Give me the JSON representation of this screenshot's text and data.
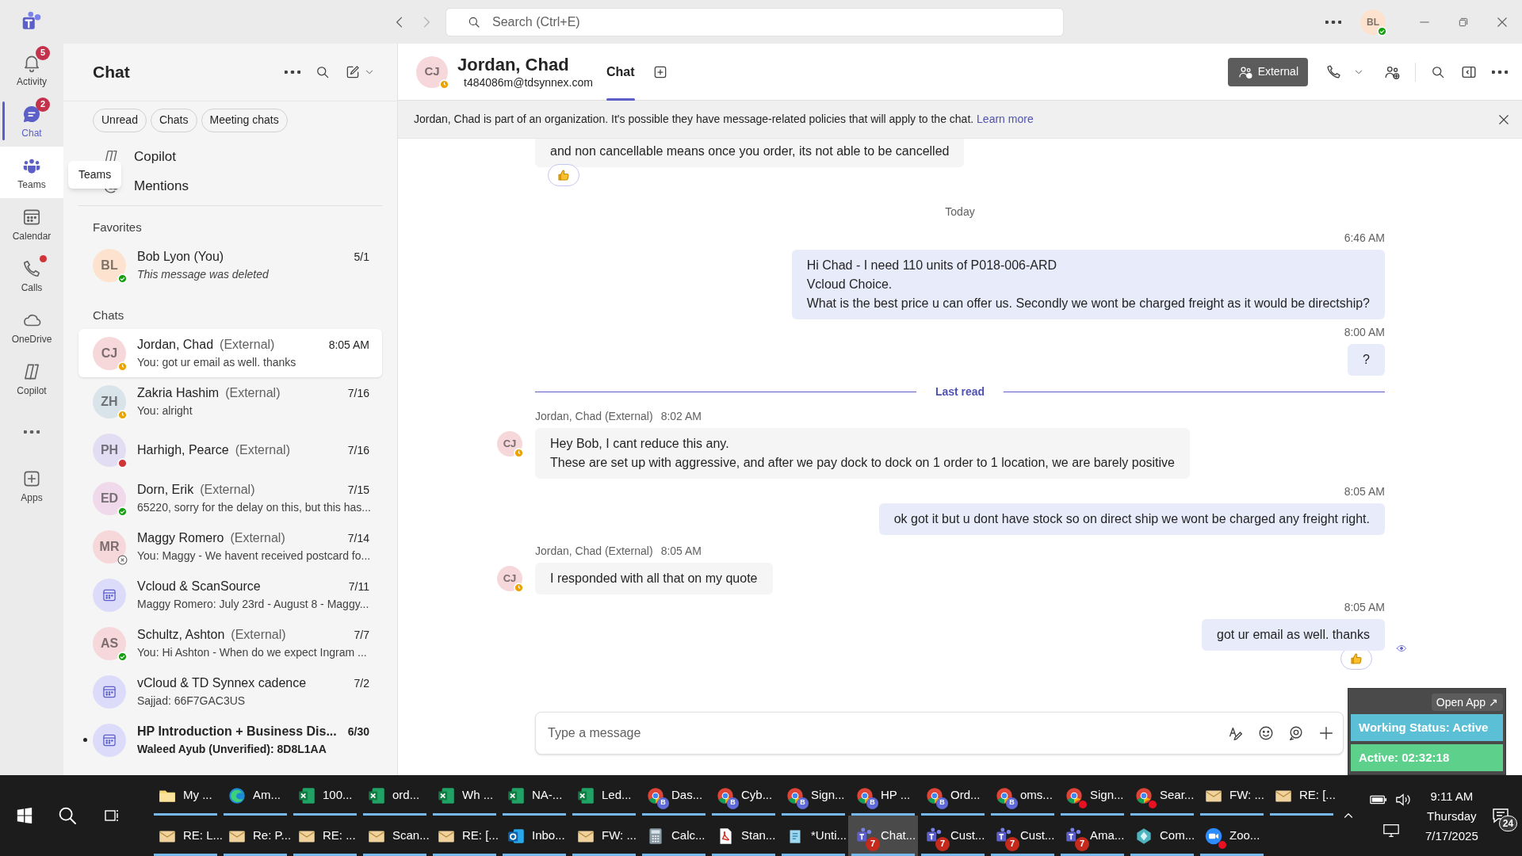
{
  "title_bar": {
    "search": {
      "placeholder": "Search (Ctrl+E)"
    },
    "avatar": {
      "initials": "BL",
      "color": "#fde3cf",
      "status": {
        "kind": "available"
      }
    }
  },
  "rail": [
    {
      "kind": "activity",
      "label": "Activity",
      "badge": "5",
      "selected": false,
      "dot": false
    },
    {
      "kind": "chat",
      "label": "Chat",
      "badge": "2",
      "selected": true,
      "dot": false
    },
    {
      "kind": "teams",
      "label": "Teams",
      "tooltip": "Teams",
      "selected": false,
      "dot": false
    },
    {
      "kind": "calendar",
      "label": "Calendar",
      "selected": false,
      "dot": false
    },
    {
      "kind": "calls",
      "label": "Calls",
      "selected": false,
      "dot": true
    },
    {
      "kind": "onedrive",
      "label": "OneDrive",
      "selected": false,
      "dot": false
    },
    {
      "kind": "copilot",
      "label": "Copilot",
      "selected": false,
      "dot": false
    },
    {
      "kind": "more",
      "selected": false,
      "dot": false
    },
    {
      "kind": "apps",
      "label": "Apps",
      "selected": false,
      "dot": false
    }
  ],
  "chat_list": {
    "title": "Chat",
    "filters": [
      "Unread",
      "Chats",
      "Meeting chats"
    ],
    "shortcuts": [
      {
        "kind": "copilot",
        "label": "Copilot"
      },
      {
        "kind": "mention",
        "label": "Mentions"
      }
    ],
    "favorites": {
      "heading": "Favorites",
      "items": [
        {
          "kind": "person",
          "initials": "BL",
          "color": "#fde3cf",
          "status": {
            "kind": "available"
          },
          "name": "Bob Lyon (You)",
          "time": "5/1",
          "preview": "This message was deleted",
          "deleted": true,
          "selected": false,
          "unread": false
        }
      ]
    },
    "chats": {
      "heading": "Chats",
      "items": [
        {
          "kind": "person",
          "initials": "CJ",
          "color": "#f6d8db",
          "status": {
            "kind": "away"
          },
          "name": "Jordan, Chad",
          "tag": "(External)",
          "time": "8:05 AM",
          "preview": "You: got ur email as well. thanks",
          "selected": true,
          "unread": false
        },
        {
          "kind": "person",
          "initials": "ZH",
          "color": "#d8e4ea",
          "status": {
            "kind": "away"
          },
          "name": "Zakria Hashim",
          "tag": "(External)",
          "time": "7/16",
          "preview": "You: alright",
          "selected": false,
          "unread": false
        },
        {
          "kind": "person",
          "initials": "PH",
          "color": "#e2ddf2",
          "status": {
            "kind": "busy"
          },
          "name": "Harhigh, Pearce",
          "tag": "(External)",
          "time": "7/16",
          "selected": false,
          "unread": false
        },
        {
          "kind": "person",
          "initials": "ED",
          "color": "#efd9ea",
          "status": {
            "kind": "available"
          },
          "name": "Dorn, Erik",
          "tag": "(External)",
          "time": "7/15",
          "preview": "65220, sorry for the delay on this, but this has...",
          "selected": false,
          "unread": false
        },
        {
          "kind": "person",
          "initials": "MR",
          "color": "#f6d8db",
          "status": {
            "kind": "offline"
          },
          "name": "Maggy Romero",
          "tag": "(External)",
          "time": "7/14",
          "preview": "You: Maggy - We havent received postcard fo...",
          "selected": false,
          "unread": false
        },
        {
          "kind": "meeting",
          "name": "Vcloud & ScanSource",
          "time": "7/11",
          "preview": "Maggy Romero: July 23rd - August 8 - Maggy...",
          "selected": false,
          "unread": false
        },
        {
          "kind": "person",
          "initials": "AS",
          "color": "#f6d8db",
          "status": {
            "kind": "available"
          },
          "name": "Schultz, Ashton",
          "tag": "(External)",
          "time": "7/7",
          "preview": "You: Hi Ashton -  When do we expect Ingram ...",
          "selected": false,
          "unread": false
        },
        {
          "kind": "meeting",
          "name": "vCloud & TD Synnex cadence",
          "time": "7/2",
          "preview": "Sajjad: 66F7GAC3US",
          "selected": false,
          "unread": false
        },
        {
          "kind": "meeting",
          "name": "HP Introduction + Business Dis...",
          "time": "6/30",
          "preview": "Waleed Ayub (Unverified): 8D8L1AA",
          "selected": false,
          "unread": true
        }
      ]
    }
  },
  "conversation": {
    "avatar": {
      "initials": "CJ",
      "color": "#f6d8db",
      "status": {
        "kind": "away"
      }
    },
    "name": "Jordan, Chad",
    "email": "t484086m@tdsynnex.com",
    "tabs": [
      {
        "label": "Chat",
        "selected": true
      }
    ],
    "external_button": "External",
    "banner": {
      "text": "Jordan, Chad is part of an organization. It's possible they have message-related policies that will apply to the chat.",
      "link": "Learn more"
    },
    "messages": [
      {
        "kind": "incoming",
        "lines": [
          "and non cancellable means once you order, its not able to be cancelled"
        ],
        "reaction": {
          "kind": "like"
        }
      },
      {
        "kind": "day",
        "text": "Today"
      },
      {
        "kind": "outgoing",
        "time": "6:46 AM",
        "lines": [
          "Hi Chad -  I need 110 units of P018-006-ARD",
          "Vcloud Choice.",
          "What is the best price u can offer us. Secondly we wont be charged freight as it would be directship?"
        ]
      },
      {
        "kind": "outgoing",
        "time": "8:00 AM",
        "lines": [
          "?"
        ]
      },
      {
        "kind": "last_read",
        "text": "Last read"
      },
      {
        "kind": "incoming",
        "sender": "Jordan, Chad (External)",
        "time": "8:02 AM",
        "avatar": {
          "initials": "CJ",
          "color": "#f6d8db",
          "status": {
            "kind": "away"
          }
        },
        "lines": [
          "Hey Bob, I cant reduce this any.",
          "These are set up with aggressive, and after we pay dock to dock on 1 order to 1 location, we are barely positive"
        ]
      },
      {
        "kind": "outgoing",
        "time": "8:05 AM",
        "lines": [
          "ok got it but u dont have stock so on direct ship we wont be charged any freight right."
        ]
      },
      {
        "kind": "incoming",
        "sender": "Jordan, Chad (External)",
        "time": "8:05 AM",
        "avatar": {
          "initials": "CJ",
          "color": "#f6d8db",
          "status": {
            "kind": "away"
          }
        },
        "lines": [
          "I responded with all that on my quote"
        ]
      },
      {
        "kind": "outgoing",
        "time": "8:05 AM",
        "lines": [
          "got ur email as well. thanks"
        ],
        "reaction": {
          "kind": "like"
        },
        "seen": true
      }
    ],
    "compose": {
      "placeholder": "Type a message"
    }
  },
  "widget": {
    "open_app": "Open App ↗",
    "status": "Working Status: Active",
    "timer": "Active: 02:32:18"
  },
  "taskbar": {
    "rows": [
      [
        {
          "kind": "folder",
          "label": "My ...",
          "selected": false
        },
        {
          "kind": "edge",
          "label": "Am...",
          "selected": false
        },
        {
          "kind": "excel",
          "label": "100...",
          "selected": false
        },
        {
          "kind": "excel",
          "label": "ord...",
          "selected": false
        },
        {
          "kind": "excel",
          "label": "Wh ...",
          "selected": false
        },
        {
          "kind": "excel",
          "label": "NA-...",
          "selected": false
        },
        {
          "kind": "excel",
          "label": "Led...",
          "selected": false
        },
        {
          "kind": "chrome",
          "label": "Das...",
          "profile": "B",
          "selected": false
        },
        {
          "kind": "chrome",
          "label": "Cyb...",
          "profile": "B",
          "selected": false
        },
        {
          "kind": "chrome",
          "label": "Sign...",
          "profile": "B",
          "selected": false
        },
        {
          "kind": "chrome",
          "label": "HP ...",
          "profile": "B",
          "selected": false
        },
        {
          "kind": "chrome",
          "label": "Ord...",
          "profile": "B",
          "selected": false
        },
        {
          "kind": "chrome",
          "label": "oms...",
          "profile": "B",
          "selected": false
        },
        {
          "kind": "chrome",
          "label": "Sign...",
          "dot": true,
          "selected": false
        },
        {
          "kind": "chrome",
          "label": "Sear...",
          "dot": true,
          "selected": false
        },
        {
          "kind": "mail",
          "label": "FW: ...",
          "selected": false
        },
        {
          "kind": "mail",
          "label": "RE: [...",
          "selected": false
        }
      ],
      [
        {
          "kind": "mail",
          "label": "RE: L...",
          "selected": false
        },
        {
          "kind": "mail",
          "label": "Re: P...",
          "selected": false
        },
        {
          "kind": "mail",
          "label": "RE: ...",
          "selected": false
        },
        {
          "kind": "mail",
          "label": "Scan...",
          "selected": false
        },
        {
          "kind": "mail",
          "label": "RE: [...",
          "selected": false
        },
        {
          "kind": "outlook",
          "label": "Inbo...",
          "selected": false
        },
        {
          "kind": "mail",
          "label": "FW: ...",
          "selected": false
        },
        {
          "kind": "calculator",
          "label": "Calc...",
          "selected": false
        },
        {
          "kind": "pdf",
          "label": "Stan...",
          "selected": false
        },
        {
          "kind": "notepad",
          "label": "*Unti...",
          "selected": false
        },
        {
          "kind": "teams",
          "label": "Chat...",
          "badge": "7",
          "selected": true
        },
        {
          "kind": "teams",
          "label": "Cust...",
          "badge": "7",
          "selected": false
        },
        {
          "kind": "teams",
          "label": "Cust...",
          "badge": "7",
          "selected": false
        },
        {
          "kind": "teams",
          "label": "Ama...",
          "badge": "7",
          "selected": false
        },
        {
          "kind": "crystal",
          "label": "Com...",
          "selected": false
        },
        {
          "kind": "zoom",
          "label": "Zoo...",
          "dot": true,
          "selected": false
        }
      ]
    ],
    "clock": {
      "time": "9:11 AM",
      "day": "Thursday",
      "date": "7/17/2025"
    },
    "notifications": "24"
  }
}
